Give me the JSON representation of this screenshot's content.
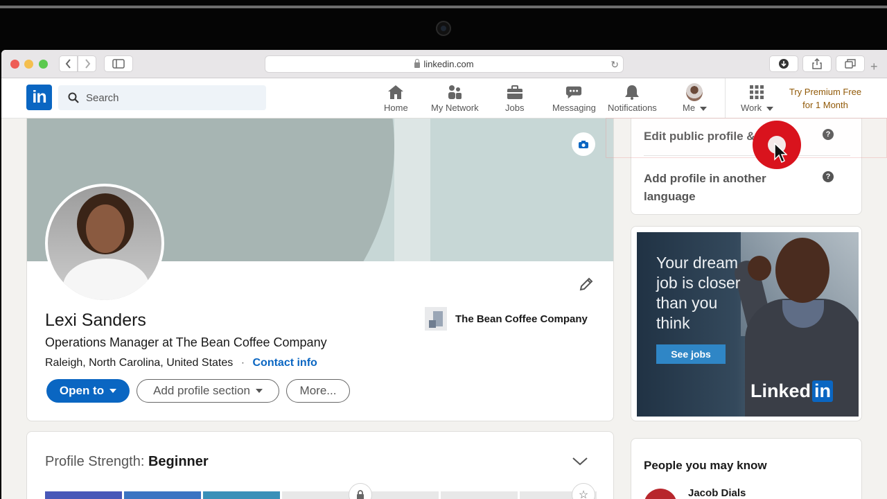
{
  "browser": {
    "url": "linkedin.com"
  },
  "nav": {
    "search_placeholder": "Search",
    "items": [
      {
        "label": "Home",
        "icon": "home-icon"
      },
      {
        "label": "My Network",
        "icon": "network-icon"
      },
      {
        "label": "Jobs",
        "icon": "briefcase-icon"
      },
      {
        "label": "Messaging",
        "icon": "messaging-icon"
      },
      {
        "label": "Notifications",
        "icon": "bell-icon"
      },
      {
        "label": "Me",
        "icon": "avatar"
      },
      {
        "label": "Work",
        "icon": "grid-icon"
      }
    ],
    "premium_line1": "Try Premium Free",
    "premium_line2": "for 1 Month"
  },
  "profile": {
    "name": "Lexi Sanders",
    "headline": "Operations Manager at The Bean Coffee Company",
    "location": "Raleigh, North Carolina, United States",
    "separator": "·",
    "contact_label": "Contact info",
    "company": "The Bean Coffee Company",
    "buttons": {
      "open_to": "Open to",
      "add_section": "Add profile section",
      "more": "More..."
    }
  },
  "strength": {
    "label": "Profile Strength:",
    "level": "Beginner",
    "filled_segments": 3,
    "total_segments": 7
  },
  "settings": {
    "edit_public": "Edit public profile & URL",
    "add_language_line1": "Add profile in another",
    "add_language_line2": "language"
  },
  "ad": {
    "line1": "Your dream",
    "line2": "job is closer",
    "line3": "than you",
    "line4": "think",
    "button": "See jobs",
    "logo_word": "Linked",
    "logo_in": "in"
  },
  "people": {
    "title": "People you may know",
    "first_name": "Jacob Dials"
  },
  "colors": {
    "brand": "#0a66c2",
    "premium": "#915907",
    "click_indicator": "#d9131d"
  }
}
